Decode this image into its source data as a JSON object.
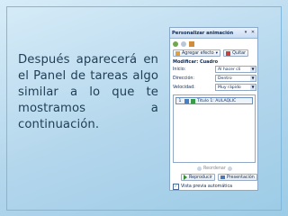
{
  "slide": {
    "text": "Después aparecerá en el Panel de tareas algo similar a lo que te mostramos a continuación."
  },
  "pane": {
    "title": "Personalizar animación",
    "add_effect_label": "Agregar efecto",
    "remove_label": "Quitar",
    "modify_label": "Modificar: Cuadro",
    "start": {
      "label": "Inicio:",
      "value": "Al hacer cli"
    },
    "direction": {
      "label": "Dirección:",
      "value": "Dentro"
    },
    "speed": {
      "label": "Velocidad:",
      "value": "Muy rápido"
    },
    "animation_list": [
      {
        "num": "1",
        "label": "Título 1: AULAQLIC"
      }
    ],
    "reorder_label": "Reordenar",
    "play_label": "Reproducir",
    "slideshow_label": "Presentación",
    "autopreview_label": "Vista previa automática",
    "autopreview_checked": true
  }
}
